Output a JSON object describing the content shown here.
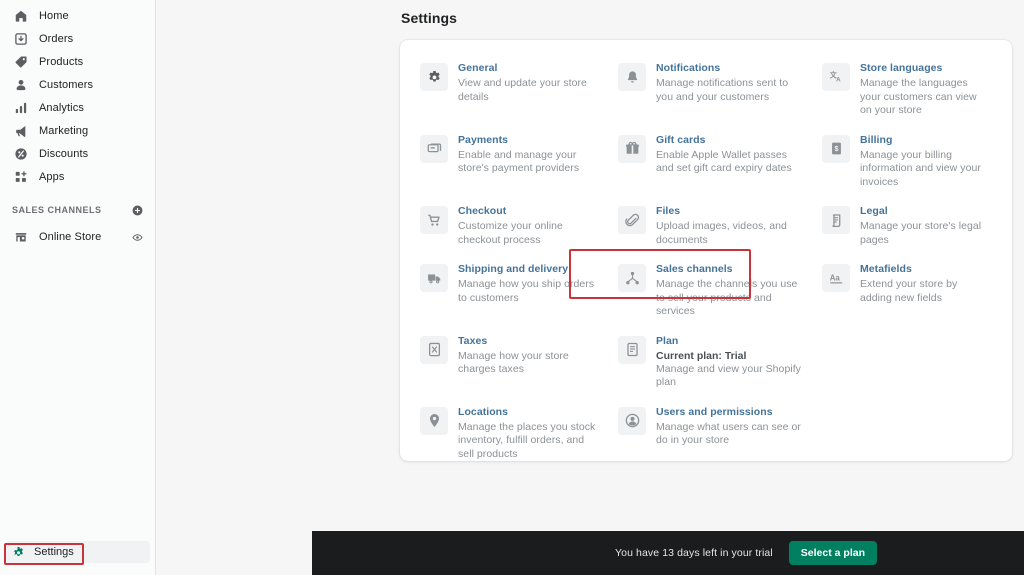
{
  "sidebar": {
    "nav_items": [
      {
        "label": "Home",
        "icon": "home-icon"
      },
      {
        "label": "Orders",
        "icon": "orders-icon"
      },
      {
        "label": "Products",
        "icon": "products-tag-icon"
      },
      {
        "label": "Customers",
        "icon": "customers-person-icon"
      },
      {
        "label": "Analytics",
        "icon": "analytics-bars-icon"
      },
      {
        "label": "Marketing",
        "icon": "marketing-megaphone-icon"
      },
      {
        "label": "Discounts",
        "icon": "discounts-percent-icon"
      },
      {
        "label": "Apps",
        "icon": "apps-grid-plus-icon"
      }
    ],
    "sales_channels_header": "SALES CHANNELS",
    "add_channel_icon": "plus-circle-icon",
    "channels": [
      {
        "label": "Online Store",
        "icon": "storefront-icon",
        "trailing_icon": "eye-icon"
      }
    ],
    "settings": {
      "label": "Settings",
      "icon": "gear-icon"
    }
  },
  "main": {
    "page_title": "Settings",
    "settings_items": [
      {
        "title": "General",
        "desc": "View and update your store details",
        "icon": "gear-icon"
      },
      {
        "title": "Notifications",
        "desc": "Manage notifications sent to you and your customers",
        "icon": "bell-icon"
      },
      {
        "title": "Store languages",
        "desc": "Manage the languages your customers can view on your store",
        "icon": "translate-icon"
      },
      {
        "title": "Payments",
        "desc": "Enable and manage your store's payment providers",
        "icon": "payment-card-icon"
      },
      {
        "title": "Gift cards",
        "desc": "Enable Apple Wallet passes and set gift card expiry dates",
        "icon": "gift-card-icon"
      },
      {
        "title": "Billing",
        "desc": "Manage your billing information and view your invoices",
        "icon": "billing-receipt-icon"
      },
      {
        "title": "Checkout",
        "desc": "Customize your online checkout process",
        "icon": "cart-icon"
      },
      {
        "title": "Files",
        "desc": "Upload images, videos, and documents",
        "icon": "paperclip-icon"
      },
      {
        "title": "Legal",
        "desc": "Manage your store's legal pages",
        "icon": "legal-scroll-icon"
      },
      {
        "title": "Shipping and delivery",
        "desc": "Manage how you ship orders to customers",
        "icon": "delivery-truck-icon",
        "highlighted": true
      },
      {
        "title": "Sales channels",
        "desc": "Manage the channels you use to sell your products and services",
        "icon": "sales-channels-nodes-icon"
      },
      {
        "title": "Metafields",
        "desc": "Extend your store by adding new fields",
        "icon": "metafields-aa-icon"
      },
      {
        "title": "Taxes",
        "desc": "Manage how your store charges taxes",
        "icon": "taxes-icon"
      },
      {
        "title": "Plan",
        "strong": "Current plan: Trial",
        "desc": "Manage and view your Shopify plan",
        "icon": "plan-document-icon"
      },
      {
        "title": "",
        "desc": "",
        "icon": "",
        "empty": true
      },
      {
        "title": "Locations",
        "desc": "Manage the places you stock inventory, fulfill orders, and sell products",
        "icon": "location-pin-icon"
      },
      {
        "title": "Users and permissions",
        "desc": "Manage what users can see or do in your store",
        "icon": "user-circle-icon"
      },
      {
        "title": "",
        "desc": "",
        "icon": "",
        "empty": true
      }
    ]
  },
  "bottom_bar": {
    "trial_text": "You have 13 days left in your trial",
    "select_plan_label": "Select a plan"
  },
  "colors": {
    "accent_green": "#008060",
    "link_blue": "#44739a",
    "highlight_red": "#c9333a",
    "bottom_bar_bg": "#1a1c1d",
    "sidebar_bg": "#fafbfb",
    "page_bg": "#f6f6f7"
  }
}
